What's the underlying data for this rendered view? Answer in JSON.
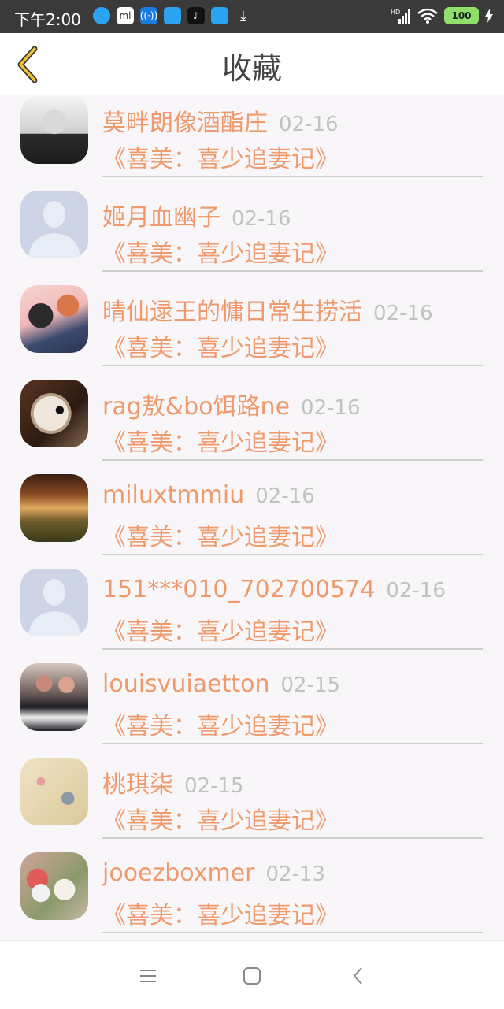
{
  "status_bar": {
    "time": "下午2:00",
    "battery": "100"
  },
  "header": {
    "title": "收藏"
  },
  "items": [
    {
      "name": "莫畔朗像酒酯庄",
      "date": "02-16",
      "book": "《喜美：喜少追妻记》",
      "avatar": "photo-grayscale-boy"
    },
    {
      "name": "姬月血幽子",
      "date": "02-16",
      "book": "《喜美：喜少追妻记》",
      "avatar": "default-user"
    },
    {
      "name": "晴仙逯王的慵日常生捞活",
      "date": "02-16",
      "book": "《喜美：喜少追妻记》",
      "avatar": "anime-couple"
    },
    {
      "name": "rag敖&bo饵路ne",
      "date": "02-16",
      "book": "《喜美：喜少追妻记》",
      "avatar": "sea-urchin"
    },
    {
      "name": "miluxtmmiu",
      "date": "02-16",
      "book": "《喜美：喜少追妻记》",
      "avatar": "autumn-forest"
    },
    {
      "name": "151***010_702700574",
      "date": "02-16",
      "book": "《喜美：喜少追妻记》",
      "avatar": "default-user"
    },
    {
      "name": "louisvuiaetton",
      "date": "02-15",
      "book": "《喜美：喜少追妻记》",
      "avatar": "couple-photo"
    },
    {
      "name": "桃琪柒",
      "date": "02-15",
      "book": "《喜美：喜少追妻记》",
      "avatar": "bird-painting"
    },
    {
      "name": "jooezboxmer",
      "date": "02-13",
      "book": "《喜美：喜少追妻记》",
      "avatar": "flowers"
    }
  ]
}
